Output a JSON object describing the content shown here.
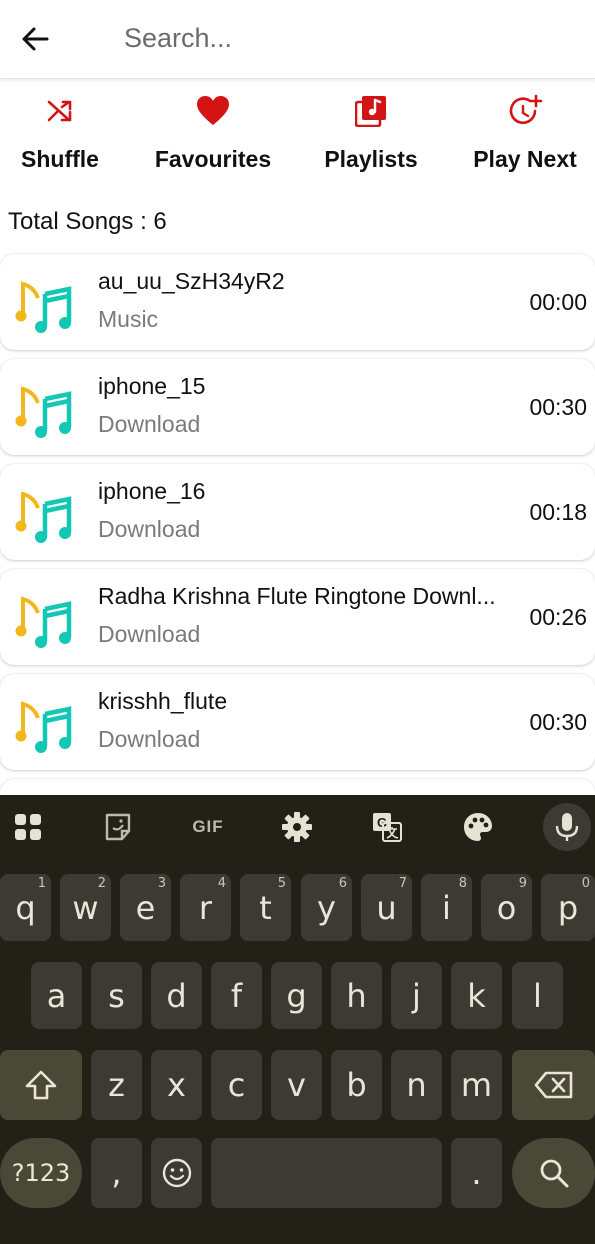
{
  "search": {
    "placeholder": "Search..."
  },
  "actions": [
    {
      "label": "Shuffle",
      "icon": "shuffle-icon"
    },
    {
      "label": "Favourites",
      "icon": "heart-icon"
    },
    {
      "label": "Playlists",
      "icon": "playlist-icon"
    },
    {
      "label": "Play Next",
      "icon": "play-next-icon"
    }
  ],
  "total_songs": "Total Songs : 6",
  "songs": [
    {
      "title": "au_uu_SzH34yR2",
      "folder": "Music",
      "duration": "00:00"
    },
    {
      "title": "iphone_15",
      "folder": "Download",
      "duration": "00:30"
    },
    {
      "title": "iphone_16",
      "folder": "Download",
      "duration": "00:18"
    },
    {
      "title": "Radha Krishna Flute Ringtone Downl...",
      "folder": "Download",
      "duration": "00:26"
    },
    {
      "title": "krisshh_flute",
      "folder": "Download",
      "duration": "00:30"
    }
  ],
  "keyboard": {
    "toolbar": [
      "apps-icon",
      "sticker-icon",
      "gif-icon",
      "settings-icon",
      "translate-icon",
      "theme-icon",
      "mic-icon"
    ],
    "gif_label": "GIF",
    "row1": [
      "q",
      "w",
      "e",
      "r",
      "t",
      "y",
      "u",
      "i",
      "o",
      "p"
    ],
    "row1_hints": [
      "1",
      "2",
      "3",
      "4",
      "5",
      "6",
      "7",
      "8",
      "9",
      "0"
    ],
    "row2": [
      "a",
      "s",
      "d",
      "f",
      "g",
      "h",
      "j",
      "k",
      "l"
    ],
    "row3": [
      "z",
      "x",
      "c",
      "v",
      "b",
      "n",
      "m"
    ],
    "symbols_label": "?123",
    "comma": ",",
    "period": "."
  },
  "colors": {
    "accent": "#d41414",
    "keyboard_bg": "#222118",
    "key": "#3b3a33",
    "special_key": "#4a4837"
  }
}
